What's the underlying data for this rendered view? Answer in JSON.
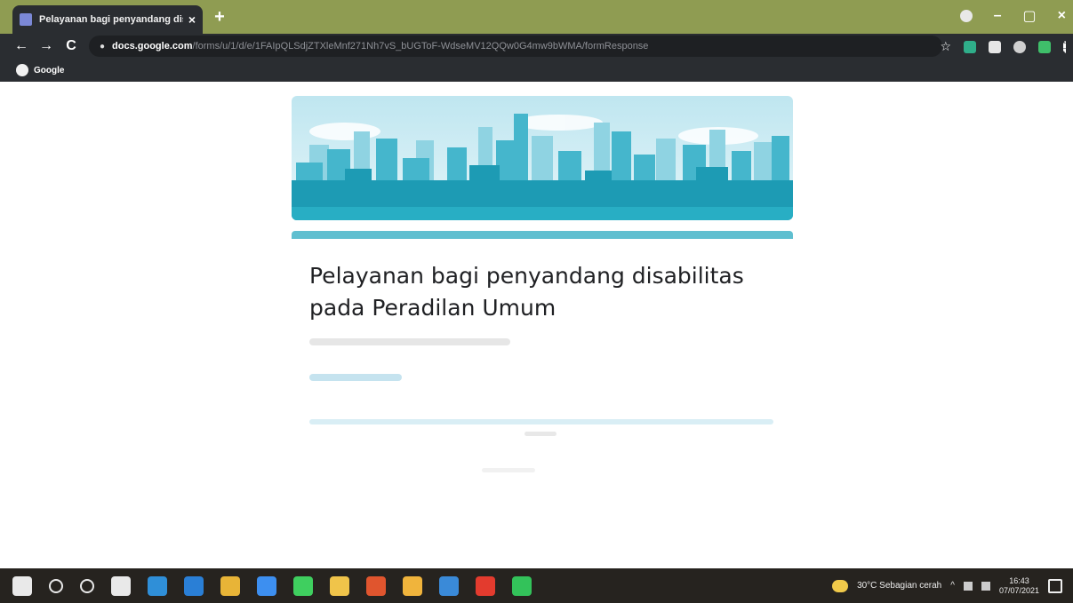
{
  "browser": {
    "tab_title": "Pelayanan bagi penyandang dis",
    "tab_close": "×",
    "new_tab": "+",
    "nav_back": "←",
    "nav_forward": "→",
    "nav_reload": "C",
    "url_host": "docs.google.com",
    "url_path": "/forms/u/1/d/e/1FAIpQLSdjZTXleMnf271Nh7vS_bUGToF-WdseMV12QQw0G4mw9bWMA/formResponse",
    "star": "☆",
    "bookmark_label": "Google",
    "window_min": "–",
    "window_restore": "▢",
    "window_close": "×"
  },
  "form": {
    "title": "Pelayanan bagi penyandang disabilitas pada Peradilan Umum"
  },
  "taskbar": {
    "weather": "30°C  Sebagian cerah",
    "tray_up": "^",
    "time": "16:43",
    "date": "07/07/2021"
  },
  "colors": {
    "accent": "#5fbfd0",
    "titlebar": "#8f9c52",
    "chrome_dark": "#2a2d31",
    "taskbar": "#26231f"
  },
  "taskbar_icons": [
    {
      "name": "windows-start-icon",
      "color": "#e9e9e9"
    },
    {
      "name": "search-icon",
      "color": "#e9e9e9"
    },
    {
      "name": "cortana-icon",
      "color": "#e9e9e9"
    },
    {
      "name": "task-view-icon",
      "color": "#e9e9e9"
    },
    {
      "name": "edge-icon",
      "color": "#2f8fd8"
    },
    {
      "name": "mail-icon",
      "color": "#2a7fd6"
    },
    {
      "name": "chrome-icon",
      "color": "#e8b437"
    },
    {
      "name": "messenger-icon",
      "color": "#3d8ff0"
    },
    {
      "name": "whatsapp-icon",
      "color": "#3fcf5f"
    },
    {
      "name": "file-explorer-icon",
      "color": "#f0c44a"
    },
    {
      "name": "office-icon",
      "color": "#e0552e"
    },
    {
      "name": "chrome-active-icon",
      "color": "#f0b43c"
    },
    {
      "name": "store-icon",
      "color": "#3a8ad8"
    },
    {
      "name": "youtube-icon",
      "color": "#e33b2e"
    },
    {
      "name": "spotify-icon",
      "color": "#33c25a"
    }
  ]
}
